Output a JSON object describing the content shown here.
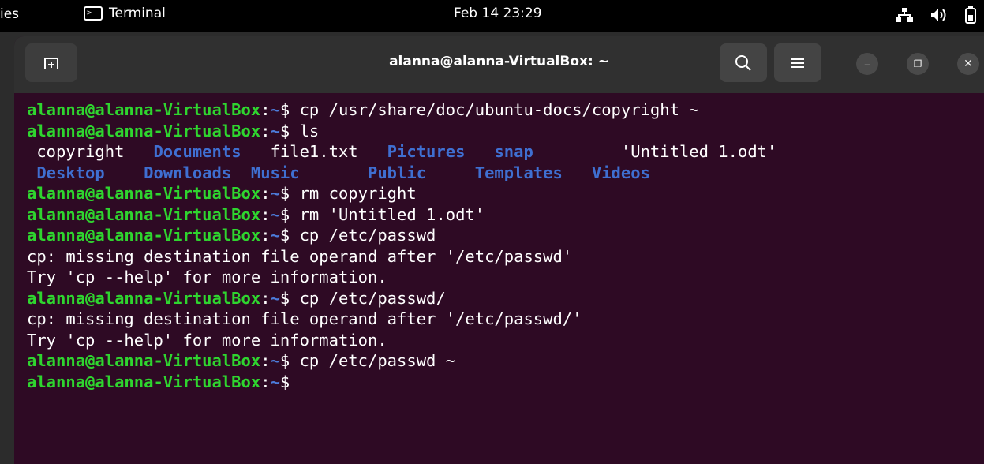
{
  "topbar": {
    "activities": "ies",
    "app_name": "Terminal",
    "clock": "Feb 14  23:29",
    "icons": [
      "network-icon",
      "volume-icon",
      "battery-icon"
    ]
  },
  "window": {
    "title": "alanna@alanna-VirtualBox: ~",
    "new_tab_icon": "new-tab-icon",
    "search_icon": "search-icon",
    "menu_icon": "hamburger-menu-icon",
    "minimize_label": "–",
    "maximize_label": "❐",
    "close_label": "✕"
  },
  "colors": {
    "prompt": "#2fd52f",
    "path": "#4c7bd9",
    "directory": "#3f6fd1",
    "background": "#2e0a24"
  },
  "terminal": {
    "prompt_user": "alanna@alanna-VirtualBox",
    "prompt_sep": ":",
    "prompt_path": "~",
    "prompt_dollar": "$ ",
    "lines": [
      {
        "type": "cmd",
        "text": "cp /usr/share/doc/ubuntu-docs/copyright ~"
      },
      {
        "type": "cmd",
        "text": "ls"
      },
      {
        "type": "ls",
        "items": [
          {
            "text": " copyright   ",
            "dir": false
          },
          {
            "text": "Documents   ",
            "dir": true
          },
          {
            "text": "file1.txt   ",
            "dir": false
          },
          {
            "text": "Pictures   ",
            "dir": true
          },
          {
            "text": "snap         ",
            "dir": true
          },
          {
            "text": "'Untitled 1.odt'",
            "dir": false
          }
        ]
      },
      {
        "type": "ls",
        "items": [
          {
            "text": " Desktop   ",
            "dir": true
          },
          {
            "text": " Downloads ",
            "dir": true
          },
          {
            "text": " Music       ",
            "dir": true
          },
          {
            "text": "Public     ",
            "dir": true
          },
          {
            "text": "Templates   ",
            "dir": true
          },
          {
            "text": "Videos",
            "dir": true
          }
        ]
      },
      {
        "type": "cmd",
        "text": "rm copyright"
      },
      {
        "type": "cmd",
        "text": "rm 'Untitled 1.odt'"
      },
      {
        "type": "cmd",
        "text": "cp /etc/passwd"
      },
      {
        "type": "out",
        "text": "cp: missing destination file operand after '/etc/passwd'"
      },
      {
        "type": "out",
        "text": "Try 'cp --help' for more information."
      },
      {
        "type": "cmd",
        "text": "cp /etc/passwd/"
      },
      {
        "type": "out",
        "text": "cp: missing destination file operand after '/etc/passwd/'"
      },
      {
        "type": "out",
        "text": "Try 'cp --help' for more information."
      },
      {
        "type": "cmd",
        "text": "cp /etc/passwd ~"
      },
      {
        "type": "cmd",
        "text": ""
      }
    ]
  }
}
